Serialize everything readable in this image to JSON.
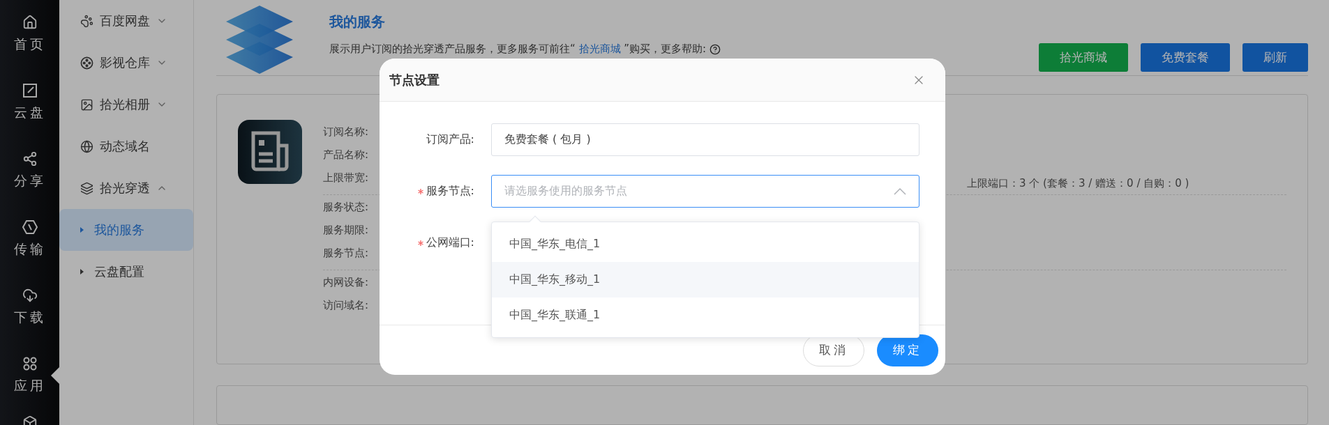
{
  "rail": {
    "items": [
      {
        "label": "首页",
        "selected": false
      },
      {
        "label": "云盘",
        "selected": false
      },
      {
        "label": "分享",
        "selected": false
      },
      {
        "label": "传输",
        "selected": false
      },
      {
        "label": "下载",
        "selected": false
      },
      {
        "label": "应用",
        "selected": true
      }
    ]
  },
  "sidebar": {
    "items": [
      {
        "label": "百度网盘",
        "kind": "group",
        "expanded": false
      },
      {
        "label": "影视仓库",
        "kind": "group",
        "expanded": false
      },
      {
        "label": "拾光相册",
        "kind": "group",
        "expanded": false
      },
      {
        "label": "动态域名",
        "kind": "link"
      },
      {
        "label": "拾光穿透",
        "kind": "group",
        "expanded": true,
        "children": [
          {
            "label": "我的服务",
            "selected": true
          },
          {
            "label": "云盘配置",
            "selected": false
          }
        ]
      }
    ]
  },
  "header": {
    "title": "我的服务",
    "description": {
      "before": "展示用户订阅的拾光穿透产品服务，更多服务可前往“ ",
      "link": "拾光商城",
      "after": " ”购买，更多帮助:"
    },
    "buttons": [
      {
        "label": "拾光商城",
        "kind": "success"
      },
      {
        "label": "免费套餐",
        "kind": "primary"
      },
      {
        "label": "刷新",
        "kind": "primary"
      }
    ]
  },
  "service_card": {
    "groups": [
      [
        "订阅名称:",
        "产品名称:",
        "上限带宽:"
      ],
      [
        "服务状态:",
        "服务期限:",
        "服务节点:"
      ],
      [
        "内网设备:",
        "访问域名:"
      ]
    ],
    "port_limit": "上限端口：3 个 (套餐：3 / 赠送：0 / 自购：0 )"
  },
  "dialog": {
    "title": "节点设置",
    "fields": [
      {
        "label": "订阅产品:",
        "required": false,
        "kind": "text",
        "value": "免费套餐 ( 包月 )"
      },
      {
        "label": "服务节点:",
        "required": true,
        "kind": "select",
        "placeholder": "请选服务使用的服务节点",
        "open": true
      },
      {
        "label": "公网端口:",
        "required": true,
        "kind": "covered"
      }
    ],
    "options": [
      {
        "label": "中国_华东_电信_1",
        "highlighted": false
      },
      {
        "label": "中国_华东_移动_1",
        "highlighted": true
      },
      {
        "label": "中国_华东_联通_1",
        "highlighted": false
      }
    ],
    "buttons": [
      {
        "label": "取消",
        "kind": "default"
      },
      {
        "label": "绑定",
        "kind": "primary"
      }
    ]
  }
}
